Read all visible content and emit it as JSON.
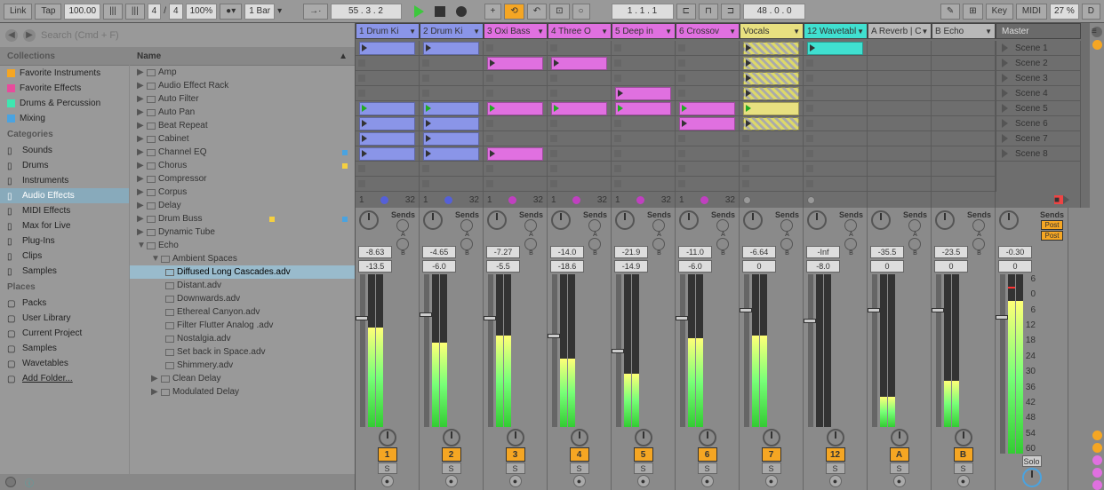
{
  "topbar": {
    "link": "Link",
    "tap": "Tap",
    "tempo": "100.00",
    "sig_num": "4",
    "sig_den": "4",
    "sig_sep": "/",
    "metronome": "100%",
    "quantize": "1 Bar",
    "bars": "55 . 3 . 2",
    "pos": "1 . 1 . 1",
    "loop": "48 . 0 . 0",
    "key": "Key",
    "midi": "MIDI",
    "cpu": "27 %",
    "disk": "D"
  },
  "search": {
    "ph": "Search (Cmd + F)"
  },
  "collections": {
    "head": "Collections",
    "items": [
      {
        "label": "Favorite Instruments",
        "color": "#f5a623"
      },
      {
        "label": "Favorite Effects",
        "color": "#e74c9c"
      },
      {
        "label": "Drums & Percussion",
        "color": "#3ee6b0"
      },
      {
        "label": "Mixing",
        "color": "#4aa3e0"
      }
    ]
  },
  "categories": {
    "head": "Categories",
    "items": [
      "Sounds",
      "Drums",
      "Instruments",
      "Audio Effects",
      "MIDI Effects",
      "Max for Live",
      "Plug-Ins",
      "Clips",
      "Samples"
    ]
  },
  "places": {
    "head": "Places",
    "items": [
      "Packs",
      "User Library",
      "Current Project",
      "Samples",
      "Wavetables",
      "Add Folder..."
    ]
  },
  "name_head": "Name",
  "devices": [
    {
      "label": "Amp"
    },
    {
      "label": "Audio Effect Rack"
    },
    {
      "label": "Auto Filter"
    },
    {
      "label": "Auto Pan"
    },
    {
      "label": "Beat Repeat"
    },
    {
      "label": "Cabinet"
    },
    {
      "label": "Channel EQ",
      "dot": "#4aa3e0"
    },
    {
      "label": "Chorus",
      "dot": "#f5d040"
    },
    {
      "label": "Compressor"
    },
    {
      "label": "Corpus"
    },
    {
      "label": "Delay"
    },
    {
      "label": "Drum Buss",
      "dot": "#f5d040",
      "dot2": "#4aa3e0"
    },
    {
      "label": "Dynamic Tube"
    },
    {
      "label": "Echo",
      "open": true,
      "children": [
        {
          "label": "Ambient Spaces",
          "open": true,
          "folder": true,
          "children": [
            {
              "label": "Diffused Long Cascades.adv",
              "sel": true
            },
            {
              "label": "Distant.adv"
            },
            {
              "label": "Downwards.adv"
            },
            {
              "label": "Ethereal Canyon.adv"
            },
            {
              "label": "Filter Flutter Analog .adv"
            },
            {
              "label": "Nostalgia.adv"
            },
            {
              "label": "Set back in Space.adv"
            },
            {
              "label": "Shimmery.adv"
            }
          ]
        },
        {
          "label": "Clean Delay",
          "folder": true
        },
        {
          "label": "Modulated Delay",
          "folder": true
        }
      ]
    }
  ],
  "tracks": [
    {
      "name": "1 Drum Ki",
      "color": "#8a95e8",
      "num": "1",
      "io": "32",
      "knob": "#5560d8",
      "db": "-8.63",
      "gain": "-13.5",
      "meter": 65,
      "fader": 70,
      "clips": [
        1,
        0,
        0,
        0,
        2,
        1,
        1,
        1,
        0,
        0
      ]
    },
    {
      "name": "2 Drum Ki",
      "color": "#8a95e8",
      "num": "2",
      "io": "32",
      "knob": "#5560d8",
      "db": "-4.65",
      "gain": "-6.0",
      "meter": 55,
      "fader": 72,
      "clips": [
        1,
        0,
        0,
        0,
        2,
        1,
        1,
        1,
        0,
        0
      ]
    },
    {
      "name": "3 Oxi Bass",
      "color": "#e070e0",
      "num": "3",
      "io": "32",
      "knob": "#c040c0",
      "db": "-7.27",
      "gain": "-5.5",
      "meter": 60,
      "fader": 70,
      "clips": [
        0,
        1,
        0,
        0,
        2,
        0,
        0,
        1,
        0,
        0
      ]
    },
    {
      "name": "4 Three O",
      "color": "#e070e0",
      "num": "4",
      "io": "32",
      "knob": "#c040c0",
      "db": "-14.0",
      "gain": "-18.6",
      "meter": 45,
      "fader": 58,
      "clips": [
        0,
        1,
        0,
        0,
        2,
        0,
        0,
        0,
        0,
        0
      ]
    },
    {
      "name": "5 Deep in",
      "color": "#e070e0",
      "num": "5",
      "io": "32",
      "knob": "#c040c0",
      "db": "-21.9",
      "gain": "-14.9",
      "meter": 35,
      "fader": 48,
      "clips": [
        0,
        0,
        0,
        1,
        2,
        0,
        0,
        0,
        0,
        0
      ]
    },
    {
      "name": "6 Crossov",
      "color": "#e070e0",
      "num": "6",
      "io": "32",
      "knob": "#c040c0",
      "db": "-11.0",
      "gain": "-6.0",
      "meter": 58,
      "fader": 70,
      "clips": [
        0,
        0,
        0,
        0,
        2,
        1,
        0,
        0,
        0,
        0
      ]
    },
    {
      "name": "Vocals",
      "color": "#e8e080",
      "num": "7",
      "io": "",
      "knob": "#888",
      "db": "-6.64",
      "gain": "0",
      "meter": 60,
      "fader": 75,
      "audio": true,
      "clips": [
        3,
        3,
        3,
        3,
        2,
        3,
        0,
        0,
        0,
        0
      ]
    },
    {
      "name": "12 Wavetabl",
      "color": "#40e0d0",
      "num": "12",
      "io": "",
      "knob": "#888",
      "db": "-Inf",
      "gain": "-8.0",
      "meter": 0,
      "fader": 68,
      "clips": [
        4,
        0,
        0,
        0,
        0,
        0,
        0,
        0,
        0,
        0
      ]
    },
    {
      "name": "A Reverb | C",
      "color": "#b8b8b8",
      "num": "A",
      "io": "",
      "knob": "",
      "db": "-35.5",
      "gain": "0",
      "meter": 20,
      "fader": 75,
      "ret": true,
      "clips": []
    },
    {
      "name": "B Echo",
      "color": "#b8b8b8",
      "num": "B",
      "io": "",
      "knob": "",
      "db": "-23.5",
      "gain": "0",
      "meter": 30,
      "fader": 75,
      "ret": true,
      "clips": []
    }
  ],
  "master": {
    "head": "Master",
    "db": "-0.30",
    "gain": "0",
    "meter": 85,
    "fader": 75,
    "post": "Post",
    "solo": "Solo"
  },
  "scenes": [
    "Scene 1",
    "Scene 2",
    "Scene 3",
    "Scene 4",
    "Scene 5",
    "Scene 6",
    "Scene 7",
    "Scene 8"
  ],
  "sends_label": "Sends",
  "sends_a": "A",
  "sends_b": "B",
  "scale_labels": [
    "6",
    "0",
    "6",
    "12",
    "18",
    "24",
    "30",
    "36",
    "42",
    "48",
    "54",
    "60"
  ],
  "s_label": "S",
  "io_one": "1"
}
